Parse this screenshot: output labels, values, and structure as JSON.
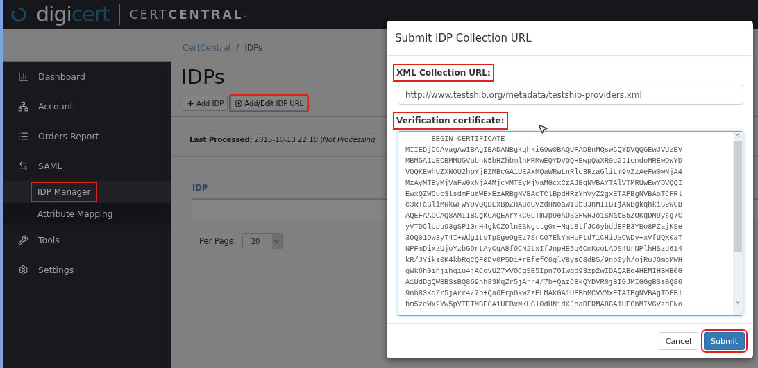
{
  "header": {
    "brand_light": "digi",
    "brand_accent": "cert",
    "product_light": "CERT",
    "product_bold": "CENTRAL",
    "trademark": "™"
  },
  "sidebar": {
    "items": [
      {
        "label": "Dashboard"
      },
      {
        "label": "Account"
      },
      {
        "label": "Orders Report"
      },
      {
        "label": "SAML",
        "children": [
          {
            "label": "IDP Manager",
            "selected": true,
            "highlighted": true
          },
          {
            "label": "Attribute Mapping",
            "selected": false,
            "highlighted": false
          }
        ]
      },
      {
        "label": "Tools"
      },
      {
        "label": "Settings"
      }
    ]
  },
  "breadcrumb": [
    "CertCentral",
    "/",
    "IDPs"
  ],
  "page_title": "IDPs",
  "toolbar": [
    {
      "label": "Add IDP",
      "kind": "add",
      "highlighted": false
    },
    {
      "label": "Add/Edit IDP URL",
      "kind": "upload",
      "highlighted": true
    }
  ],
  "last_processed": "**Last Processed:** 2015-10-13 22:10 (*Not Processing*",
  "table": {
    "columns": [
      "IDP"
    ]
  },
  "per_page": {
    "label": "Per Page:",
    "value": "20"
  },
  "dialog": {
    "title": "Submit IDP Collection URL",
    "url_label": {
      "text": "XML Collection URL:",
      "highlighted": true
    },
    "url_value": "http://www.testshib.org/metadata/testshib-providers.xml",
    "cert_label": {
      "text": "Verification certificate:",
      "highlighted": true
    },
    "cert_lines": [
      "----- BEGIN CERTIFICATE -----",
      "MIIEDjCCAvagAwIBAgIBADANBgkqhkiG9w0BAQUFADBnMQswCQYDVQQGEwJVUzEV",
      "MBMGA1UECBMMUGVubnN5bHZhbmlhMRMwEQYDVQQHEwpQaXR0c2J1cmdoMREwDwYD",
      "VQQKEwhUZXN0U2hpYjEZMBcGA1UEAxMQaWRwLnRlc3RzaGliLm9yZzAeFw0wNjA4",
      "MzAyMTEyMjVaFw0xNjA4MjcyMTEyMjVaMGcxCzAJBgNVBAYTAlVTMRUwEwYDVQQI",
      "EwxQZW5uc3lsdmFuaWExEzARBgNVBAcTClBpdHRzYnVyZ2gxETAPBgNVBAoTCFRl",
      "c3RTaGliMRkwFwYDVQQDExBpZHAudGVzdHNoaWIub3JnMIIBIjANBgkqhkiG9w0B",
      "AQEFAAOCAQ8AMIIBCgKCAQEArYkCGuTmJp9eAOSGHwRJo1SNatB5ZOKqDM9ysg7C",
      "yVTDClcpu93gSP10nH4gkCZOlnESNgttg0r+MqL8tfJC6ybddEFB3YBo8PZajKSe",
      "3OQ01Ow3yT4I+Wdg1tsTpSge9gEz7SrC07EkYmHuPtd71CHiUaCWDv+xVfUQX0aT",
      "NPFmDixzUjoYzbGDrtAyCqA8f9CN2txIfJnpHE6q6CmKcoLADS4UrNPlhHSzd614",
      "kR/JYiks0K4kbRqCQF0Dv0P5Di+rEfefC6glV8ysC8dB5/9nb0yh/ojRuJGmgMWH",
      "gWk6h0ihjihqiu4jACovUZ7vVOCgSE5Ipn7OIwqd93zp2wIDAQABo4HEMIHBMB0G",
      "A1UdDgQWBBSsBQ869nh83KqZr5jArr4/7b+QazCBkQYDVR0jBIGJMIGGgBSsBQ86",
      "9nh83KqZr5jArr4/7b+Qa6FrpGkwZzELMAkGA1UEBhMCVVMxFTATBgNVBAgTDFBl",
      "bm5zeWx2YW5pYTETMBEGA1UEBxMKUGl0dHNidXJnaDERMA8GA1UEChMIVGVzdFNo"
    ],
    "buttons": [
      {
        "label": "Cancel",
        "kind": "default",
        "highlighted": false
      },
      {
        "label": "Submit",
        "kind": "primary",
        "highlighted": true
      }
    ]
  }
}
